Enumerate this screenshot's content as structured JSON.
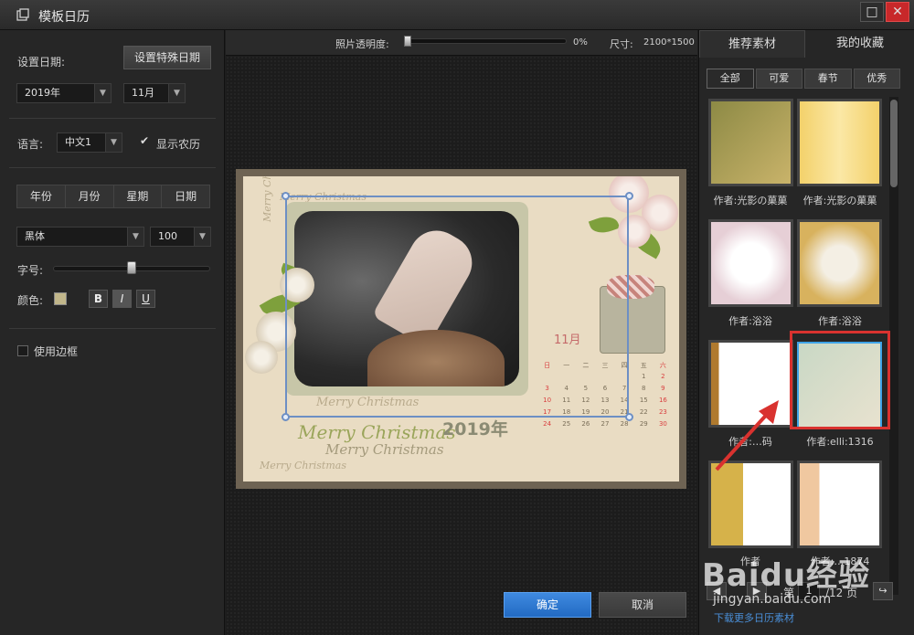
{
  "window": {
    "title": "模板日历",
    "maximize_icon": "□",
    "close_icon": "✕"
  },
  "left": {
    "date_label": "设置日期:",
    "special_date_button": "设置特殊日期",
    "year_value": "2019年",
    "month_value": "11月",
    "language_label": "语言:",
    "language_value": "中文1",
    "show_lunar_label": "显示农历",
    "show_lunar_checked": true,
    "segments": [
      "年份",
      "月份",
      "星期",
      "日期"
    ],
    "font_value": "黑体",
    "size_value": "100",
    "font_size_label": "字号:",
    "font_size_level": 0.5,
    "color_label": "颜色:",
    "color_value": "#c1b68a",
    "bold_label": "B",
    "italic_label": "I",
    "underline_label": "U",
    "border_label": "使用边框",
    "border_checked": false
  },
  "center": {
    "opacity_label": "照片透明度:",
    "opacity_value": "0%",
    "opacity_level": 0,
    "size_label": "尺寸:",
    "size_value": "2100*1500",
    "preview": {
      "month": "11月",
      "year": "2019年",
      "decor_text": "Merry Christmas",
      "weekdays": [
        "日",
        "一",
        "二",
        "三",
        "四",
        "五",
        "六"
      ],
      "weeks": [
        [
          "",
          "",
          "",
          "",
          "",
          "1",
          "2"
        ],
        [
          "3",
          "4",
          "5",
          "6",
          "7",
          "8",
          "9"
        ],
        [
          "10",
          "11",
          "12",
          "13",
          "14",
          "15",
          "16"
        ],
        [
          "17",
          "18",
          "19",
          "20",
          "21",
          "22",
          "23"
        ],
        [
          "24",
          "25",
          "26",
          "27",
          "28",
          "29",
          "30"
        ]
      ]
    },
    "ok_button": "确定",
    "cancel_button": "取消"
  },
  "right": {
    "tabs": [
      "推荐素材",
      "我的收藏"
    ],
    "filters": [
      "全部",
      "可爱",
      "春节",
      "优秀"
    ],
    "thumbnails": [
      {
        "caption": "作者:光影の菓菓"
      },
      {
        "caption": "作者:光影の菓菓"
      },
      {
        "caption": "作者:浴浴"
      },
      {
        "caption": "作者:浴浴"
      },
      {
        "caption": "作者:…码"
      },
      {
        "caption": "作者:elli:1316"
      },
      {
        "caption": "作者"
      },
      {
        "caption": "作者:…1874"
      }
    ],
    "pager": {
      "prefix": "第",
      "current": "1",
      "total": "/12 页"
    },
    "more_link": "下载更多日历素材"
  },
  "watermark": {
    "main": "Baidu经验",
    "sub": "jingyan.baidu.com"
  },
  "colors": {
    "accent_blue": "#2f7ad6",
    "highlight_red": "#d9322f",
    "selection_blue": "#6d8fc4"
  }
}
